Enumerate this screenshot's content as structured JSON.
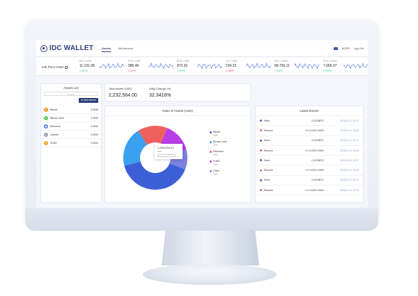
{
  "app": {
    "name": "IDC WALLET"
  },
  "nav": {
    "items": [
      "Assets",
      "My Account"
    ]
  },
  "user": {
    "account": "ACER",
    "logout": "Log Out"
  },
  "tickers": {
    "label": "24h Price Chart",
    "items": [
      {
        "pair": "BTC / USD",
        "value": "11,131.98",
        "change": "1.302%",
        "trend": "up"
      },
      {
        "pair": "ETH / USD",
        "value": "985.46",
        "change": "0.115%",
        "trend": "down"
      },
      {
        "pair": "BCH / USD",
        "value": "873.02",
        "change": "3.384%",
        "trend": "up"
      },
      {
        "pair": "LTC / USD",
        "value": "234.23",
        "change": "0.186%",
        "trend": "down"
      },
      {
        "pair": "BTC / VHKD",
        "value": "89,756.11",
        "change": "1.302%",
        "trend": "up"
      },
      {
        "pair": "ETH / VHKD",
        "value": "7,065.07",
        "change": "0.086%",
        "trend": "up"
      }
    ]
  },
  "assets": {
    "title": "Assets List",
    "search_placeholder": "Search",
    "add_label": "Add Assets",
    "items": [
      {
        "name": "Bitcoin",
        "amount": "0.0000",
        "color": "#f7931a",
        "glyph": "B"
      },
      {
        "name": "Bitcoin Cash",
        "amount": "0.0000",
        "color": "#4cc74a",
        "glyph": "B"
      },
      {
        "name": "Ethereum",
        "amount": "0.0000",
        "color": "#627eea",
        "glyph": "◆"
      },
      {
        "name": "Litecoin",
        "amount": "0.0000",
        "color": "#9aa3b0",
        "glyph": "Ł"
      },
      {
        "name": "VHKD",
        "amount": "0.0000",
        "color": "#f5a623",
        "glyph": "V"
      }
    ]
  },
  "stats": {
    "total_label": "Total Assets (USD)",
    "total_value": "2,232,564.00",
    "change_label": "Daily Change (%)",
    "change_value": "32.3416%"
  },
  "ratio": {
    "title": "Ratio of Assets (USD)",
    "tooltip": {
      "value": "1,234,234.21",
      "percent": "40%"
    },
    "legend": [
      {
        "name": "Bitcoin",
        "pct": "40%",
        "color": "#3d5fd6"
      },
      {
        "name": "Bitcoin Cash",
        "pct": "20%",
        "color": "#3aa0f0"
      },
      {
        "name": "Ethereum",
        "pct": "15%",
        "color": "#f0605d"
      },
      {
        "name": "VHKD",
        "pct": "15%",
        "color": "#b83ee8"
      },
      {
        "name": "Other",
        "pct": "10%",
        "color": "#7a7fe0"
      }
    ]
  },
  "chart_data": {
    "type": "pie",
    "title": "Ratio of Assets (USD)",
    "categories": [
      "Bitcoin",
      "Bitcoin Cash",
      "Ethereum",
      "VHKD",
      "Other"
    ],
    "values": [
      40,
      20,
      15,
      15,
      10
    ]
  },
  "events": {
    "title": "Latest Events",
    "items": [
      {
        "type": "Send",
        "amount": "-0.10238TC",
        "time": "2018.01.11 13:37"
      },
      {
        "type": "Receive",
        "amount": "+1+2.1023 VHKD",
        "time": "2018.01.11 13:33"
      },
      {
        "type": "Send",
        "amount": "-0.10238TC",
        "time": "2018.01.11 13:37"
      },
      {
        "type": "Receive",
        "amount": "+1+2.1023 VHKD",
        "time": "2018.01.11 13:33"
      },
      {
        "type": "Send",
        "amount": "-0.10238TC",
        "time": "2018.01.11 13:37"
      },
      {
        "type": "Receive",
        "amount": "+1+2.1023 VHKD",
        "time": "2018.01.11 13:33"
      },
      {
        "type": "Send",
        "amount": "-0.10238TC",
        "time": "2018.01.11 13:37"
      },
      {
        "type": "Receive",
        "amount": "+1+2.1023 VHKD",
        "time": "2018.01.11 13:33"
      }
    ]
  },
  "colors": {
    "brand": "#2c3e7a",
    "up": "#2ec4a0",
    "down": "#e8555d",
    "sparkline": "#4a6be0"
  }
}
